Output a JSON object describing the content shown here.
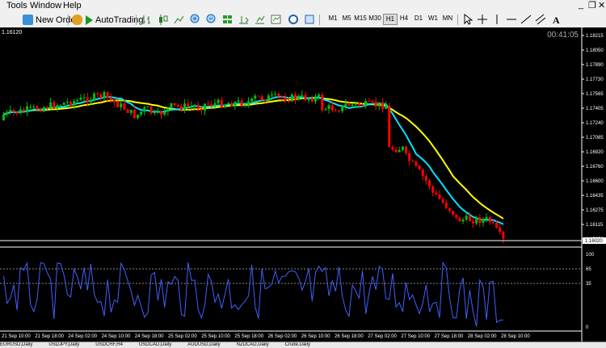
{
  "menu": {
    "tools": "Tools",
    "window": "Window",
    "help": "Help"
  },
  "toolbar": {
    "new_order": "New Order",
    "autotrading": "AutoTrading",
    "timeframes": [
      "M1",
      "M5",
      "M15",
      "M30",
      "H1",
      "H4",
      "D1",
      "W1",
      "MN"
    ]
  },
  "chart_data": {
    "type": "candlestick",
    "price_label": "1.16120",
    "timer": "00:41:05",
    "current_price": "1.16020",
    "yticks": [
      "1.18215",
      "1.18050",
      "1.17890",
      "1.17730",
      "1.17565",
      "1.17405",
      "1.17240",
      "1.17085",
      "1.16920",
      "1.16760",
      "1.16600",
      "1.16435",
      "1.16275",
      "1.16115",
      "1.15950"
    ],
    "xticks": [
      "21 Sep 10:00",
      "21 Sep 18:00",
      "24 Sep 02:00",
      "24 Sep 10:00",
      "24 Sep 18:00",
      "25 Sep 02:00",
      "25 Sep 10:00",
      "25 Sep 18:00",
      "26 Sep 02:00",
      "26 Sep 10:00",
      "26 Sep 18:00",
      "27 Sep 02:00",
      "27 Sep 10:00",
      "27 Sep 18:00",
      "28 Sep 02:00",
      "28 Sep 10:00"
    ],
    "osc_ticks": [
      "100",
      "65",
      "35",
      "0"
    ],
    "colors": {
      "bull": "#00c000",
      "bear": "#ff0000",
      "fast_ma": "#00e5ff",
      "slow_ma": "#ffff00",
      "osc": "#4060ff"
    }
  },
  "bottom_tabs": [
    "EURUSD,Daily",
    "USDJPY,Daily",
    "USDCHF,H4",
    "USDCAD,Daily",
    "AUDUSD,Daily",
    "NZDCAD,Daily",
    "Crude,Daily"
  ]
}
